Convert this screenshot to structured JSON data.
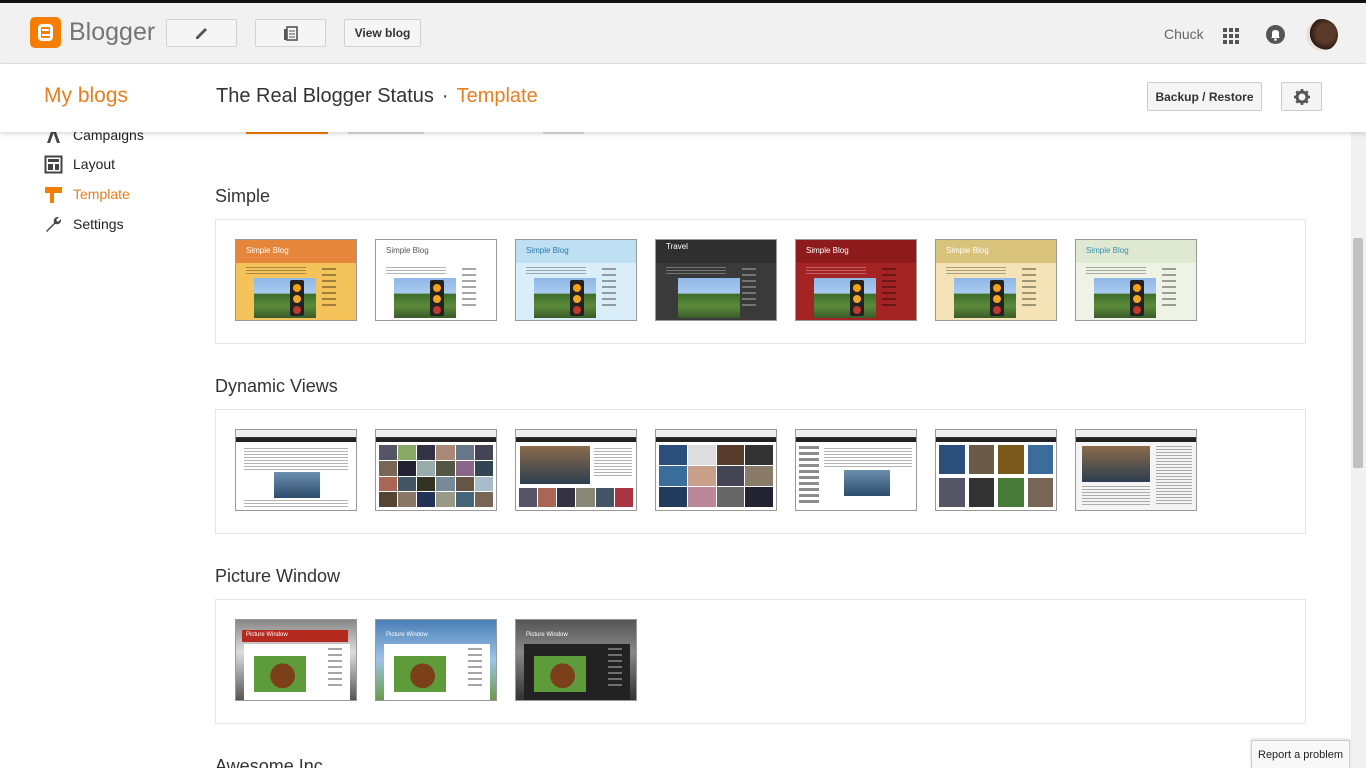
{
  "topbar": {
    "app_name": "Blogger",
    "view_blog_label": "View blog",
    "user_name": "Chuck"
  },
  "header": {
    "my_blogs": "My blogs",
    "blog_title": "The Real Blogger Status",
    "separator": "·",
    "section": "Template",
    "backup_label": "Backup / Restore"
  },
  "sidebar": {
    "items": [
      {
        "label": "Campaigns",
        "icon": "campaigns-icon"
      },
      {
        "label": "Layout",
        "icon": "layout-icon"
      },
      {
        "label": "Template",
        "icon": "template-icon",
        "active": true
      },
      {
        "label": "Settings",
        "icon": "wrench-icon"
      }
    ]
  },
  "sections": [
    {
      "title": "Simple",
      "thumbs": [
        {
          "label": "Simple Blog",
          "header_color": "#e5863a",
          "bg": "#f4c45a"
        },
        {
          "label": "Simple Blog",
          "header_color": "#ffffff",
          "bg": "#ffffff"
        },
        {
          "label": "Simple Blog",
          "header_color": "#bfe0f2",
          "bg": "#d9eef8"
        },
        {
          "label": "Travel",
          "header_color": "#2f2f2f",
          "bg": "#3a3a3a"
        },
        {
          "label": "Simple Blog",
          "header_color": "#8e1b1b",
          "bg": "#a42323"
        },
        {
          "label": "Simple Blog",
          "header_color": "#d9c27a",
          "bg": "#f3e3b6"
        },
        {
          "label": "Simple Blog",
          "header_color": "#dfe9d2",
          "bg": "#eef3e6"
        }
      ]
    },
    {
      "title": "Dynamic Views",
      "count": 7
    },
    {
      "title": "Picture Window",
      "thumbs": [
        {
          "label": "Picture Window",
          "header_color": "#b52a1f"
        },
        {
          "label": "Picture Window",
          "header_color": "#4a7fb8"
        },
        {
          "label": "Picture Window",
          "header_color": "#333333"
        }
      ]
    },
    {
      "title": "Awesome Inc."
    }
  ],
  "report_label": "Report a problem",
  "colors": {
    "accent": "#e67e22",
    "brand": "#f57d00"
  }
}
